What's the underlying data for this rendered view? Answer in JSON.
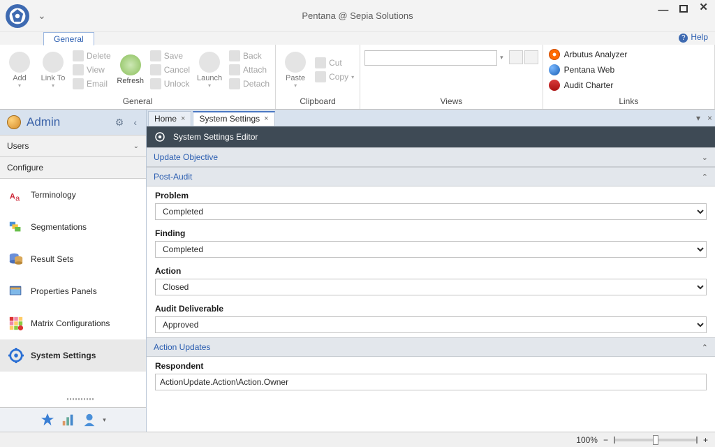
{
  "window": {
    "title": "Pentana @ Sepia Solutions"
  },
  "help": {
    "label": "Help"
  },
  "ribbon": {
    "primary_tab": "General",
    "groups": {
      "general": {
        "label": "General",
        "add": "Add",
        "link_to": "Link To",
        "delete": "Delete",
        "view": "View",
        "email": "Email",
        "refresh": "Refresh",
        "save": "Save",
        "cancel": "Cancel",
        "unlock": "Unlock",
        "launch": "Launch",
        "back": "Back",
        "attach": "Attach",
        "detach": "Detach"
      },
      "clipboard": {
        "label": "Clipboard",
        "paste": "Paste",
        "cut": "Cut",
        "copy": "Copy"
      },
      "views": {
        "label": "Views",
        "search_placeholder": ""
      },
      "links": {
        "label": "Links",
        "arbutus": "Arbutus Analyzer",
        "pentana_web": "Pentana Web",
        "audit_charter": "Audit Charter"
      }
    }
  },
  "sidebar": {
    "title": "Admin",
    "sections": {
      "users": "Users",
      "configure": "Configure"
    },
    "items": [
      {
        "label": "Terminology"
      },
      {
        "label": "Segmentations"
      },
      {
        "label": "Result Sets"
      },
      {
        "label": "Properties Panels"
      },
      {
        "label": "Matrix Configurations"
      },
      {
        "label": "System Settings"
      }
    ]
  },
  "tabs": {
    "home": "Home",
    "system_settings": "System Settings"
  },
  "editor": {
    "title": "System Settings Editor",
    "panels": {
      "update_objective": "Update Objective",
      "post_audit": "Post-Audit",
      "action_updates": "Action Updates"
    },
    "post_audit": {
      "problem": {
        "label": "Problem",
        "value": "Completed"
      },
      "finding": {
        "label": "Finding",
        "value": "Completed"
      },
      "action": {
        "label": "Action",
        "value": "Closed"
      },
      "audit_deliverable": {
        "label": "Audit Deliverable",
        "value": "Approved"
      }
    },
    "action_updates": {
      "respondent": {
        "label": "Respondent",
        "value": "ActionUpdate.Action\\Action.Owner"
      }
    }
  },
  "status": {
    "zoom": "100%"
  }
}
